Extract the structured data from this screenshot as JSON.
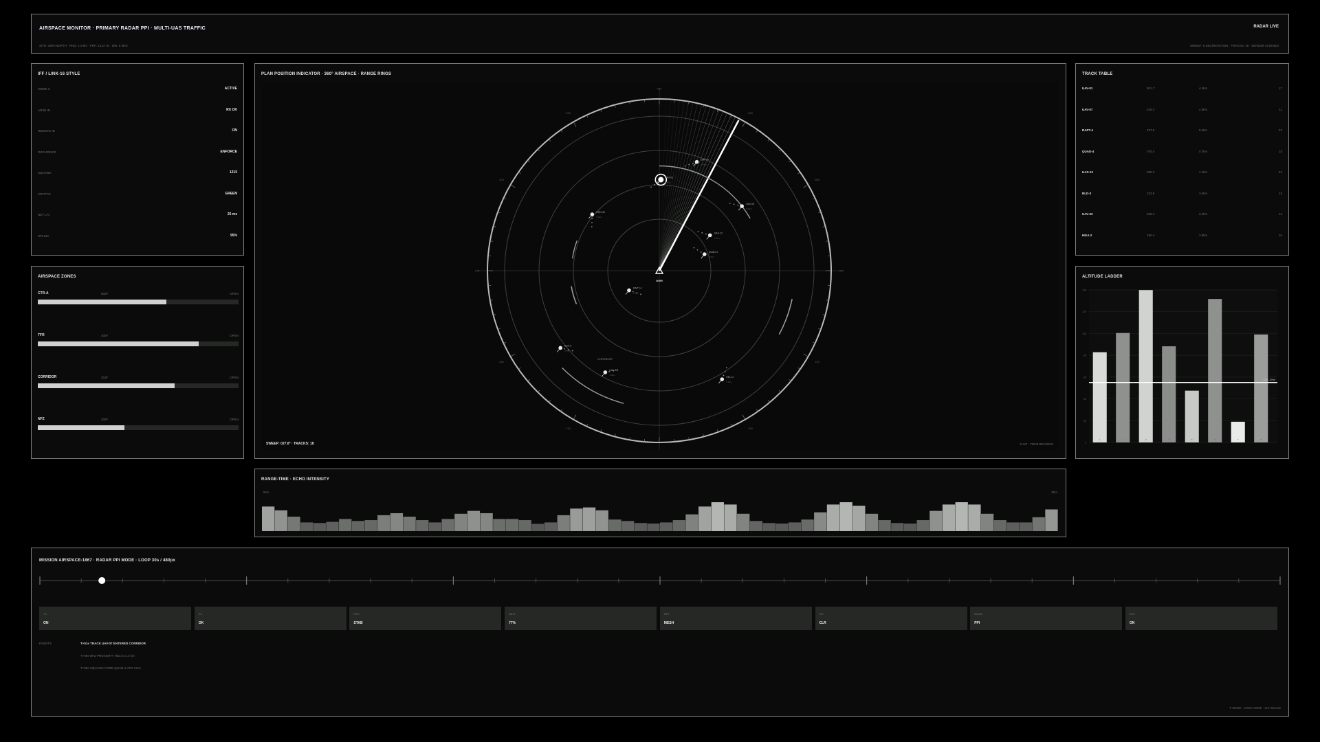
{
  "header": {
    "title": "AIRSPACE MONITOR · PRIMARY RADAR PPI · MULTI-UAS TRAFFIC",
    "subtitle": "SITE: GRD-NORTH · RNG: 1.8 km · PRF: 1214 Hz · BW: 8 MHz",
    "status": "RADAR LIVE",
    "right_sub": "SWEEP: 6 SEC/ROTATION · TRACKS: 18 · SENSOR ALIGNED"
  },
  "iff": {
    "title": "IFF / LINK-16 STYLE",
    "rows": [
      {
        "k": "MODE 3",
        "v": "ACTIVE"
      },
      {
        "k": "ADSB IN",
        "v": "RX OK"
      },
      {
        "k": "REMOTE ID",
        "v": "ON"
      },
      {
        "k": "GEO-FENCE",
        "v": "ENFORCE"
      },
      {
        "k": "SQUAWK",
        "v": "1215"
      },
      {
        "k": "CRYPTO",
        "v": "GREEN"
      },
      {
        "k": "NET LAT",
        "v": "25 ms"
      },
      {
        "k": "UPLINK",
        "v": "95%"
      }
    ]
  },
  "zones": {
    "title": "AIRSPACE ZONES",
    "items": [
      {
        "name": "CTR-A",
        "code": "800F",
        "status": "OPEN",
        "level": 0.64
      },
      {
        "name": "TFR",
        "code": "400F",
        "status": "OPEN",
        "level": 0.8
      },
      {
        "name": "CORRIDOR",
        "code": "301F",
        "status": "OPEN",
        "level": 0.68
      },
      {
        "name": "NFZ",
        "code": "200F",
        "status": "OPEN",
        "level": 0.43
      }
    ]
  },
  "ppi": {
    "title": "PLAN POSITION INDICATOR · 360° AIRSPACE · RANGE RINGS",
    "sweep_label": "SWEEP: 027.8° · TRACKS: 18",
    "north_up": "N-UP · TRUE BEARING",
    "center_label": "GWR",
    "bearings": [
      "000",
      "030",
      "060",
      "090",
      "120",
      "150",
      "180",
      "210",
      "240",
      "270",
      "300",
      "330"
    ],
    "tracks": [
      {
        "id": "UAV-01",
        "sub": "4.2km",
        "bearing": 1,
        "range": 0.53,
        "big": true
      },
      {
        "id": "UAV-07",
        "sub": "4.6km",
        "bearing": 19,
        "range": 0.67
      },
      {
        "id": "UAV-05",
        "sub": "3.9km",
        "bearing": 52,
        "range": 0.61
      },
      {
        "id": "DRN-09",
        "sub": "2.1km",
        "bearing": 310,
        "range": 0.51
      },
      {
        "id": "UAS-12",
        "sub": "1.1km",
        "bearing": 55,
        "range": 0.36
      },
      {
        "id": "QUAD-4",
        "sub": "0.7km",
        "bearing": 70,
        "range": 0.28
      },
      {
        "id": "RAPT-4",
        "sub": "0.6km",
        "bearing": 237,
        "range": 0.21
      },
      {
        "id": "BLD-3",
        "sub": "3.6km",
        "bearing": 232,
        "range": 0.73
      },
      {
        "id": "UAV-33",
        "sub": "3.4km",
        "bearing": 208,
        "range": 0.67
      },
      {
        "id": "HELI-2",
        "sub": "3.9km",
        "bearing": 150,
        "range": 0.73
      }
    ],
    "corridor_label": "CORRIDOR"
  },
  "track_table": {
    "title": "TRACK TABLE",
    "rows": [
      {
        "id": "UAV-01",
        "brg": "001.7",
        "rng": "4.2km",
        "q": "17"
      },
      {
        "id": "UAV-07",
        "brg": "019.3",
        "rng": "4.6km",
        "q": "11"
      },
      {
        "id": "RAPT-4",
        "brg": "237.5",
        "rng": "0.6km",
        "q": "22"
      },
      {
        "id": "QUAD-4",
        "brg": "070.4",
        "rng": "0.7km",
        "q": "15"
      },
      {
        "id": "UAS-12",
        "brg": "055.2",
        "rng": "1.1km",
        "q": "21"
      },
      {
        "id": "BLD-3",
        "brg": "232.6",
        "rng": "3.6km",
        "q": "13"
      },
      {
        "id": "UAV-33",
        "brg": "208.1",
        "rng": "3.4km",
        "q": "11"
      },
      {
        "id": "HELI-2",
        "brg": "150.4",
        "rng": "3.9km",
        "q": "10"
      }
    ]
  },
  "altitude": {
    "title": "ALTITUDE LADDER",
    "ceiling_label": "CEIL 120m",
    "ticks": [
      "140",
      "120",
      "100",
      "80",
      "60",
      "40",
      "20",
      "0"
    ],
    "bars": [
      0.61,
      0.74,
      1.03,
      0.65,
      0.35,
      0.97,
      0.14,
      0.73
    ],
    "bar_labels": [
      "1",
      "2",
      "3",
      "4",
      "5",
      "6",
      "7",
      "8"
    ]
  },
  "echo": {
    "title": "RANGE-TIME · ECHO INTENSITY",
    "left_label": "0km",
    "right_label": "5km",
    "values": [
      0.85,
      0.72,
      0.5,
      0.3,
      0.28,
      0.32,
      0.42,
      0.35,
      0.38,
      0.55,
      0.62,
      0.5,
      0.38,
      0.3,
      0.42,
      0.6,
      0.7,
      0.62,
      0.42,
      0.42,
      0.38,
      0.25,
      0.3,
      0.55,
      0.78,
      0.82,
      0.72,
      0.4,
      0.35,
      0.28,
      0.26,
      0.3,
      0.38,
      0.58,
      0.85,
      1.0,
      0.92,
      0.6,
      0.35,
      0.28,
      0.26,
      0.3,
      0.4,
      0.65,
      0.92,
      1.0,
      0.88,
      0.6,
      0.38,
      0.28,
      0.26,
      0.38,
      0.7,
      0.92,
      1.0,
      0.92,
      0.6,
      0.38,
      0.3,
      0.3,
      0.48,
      0.75
    ]
  },
  "mission": {
    "title": "MISSION AIRSPACE-1867 · RADAR PPI MODE · LOOP 30s / 480px",
    "progress": 0.05,
    "status": [
      {
        "k": "TX",
        "v": "ON"
      },
      {
        "k": "RX",
        "v": "OK"
      },
      {
        "k": "PED",
        "v": "STAB"
      },
      {
        "k": "BATT",
        "v": "77%"
      },
      {
        "k": "NET",
        "v": "MESH"
      },
      {
        "k": "WX",
        "v": "CLR"
      },
      {
        "k": "MODE",
        "v": "PPI"
      },
      {
        "k": "REC",
        "v": "ON"
      }
    ],
    "events_label": "EVENTS",
    "events": [
      "T+01s  TRACK UAV-07 ENTERED CORRIDOR",
      "T+06s  NFZ PROXIMITY HELI-2  4.4 km",
      "T+08s  SQUAWK CODE QUAD-4  VFR 1214"
    ],
    "footer": "T+00:00 · LOCK CORE · ALT SCALE"
  }
}
